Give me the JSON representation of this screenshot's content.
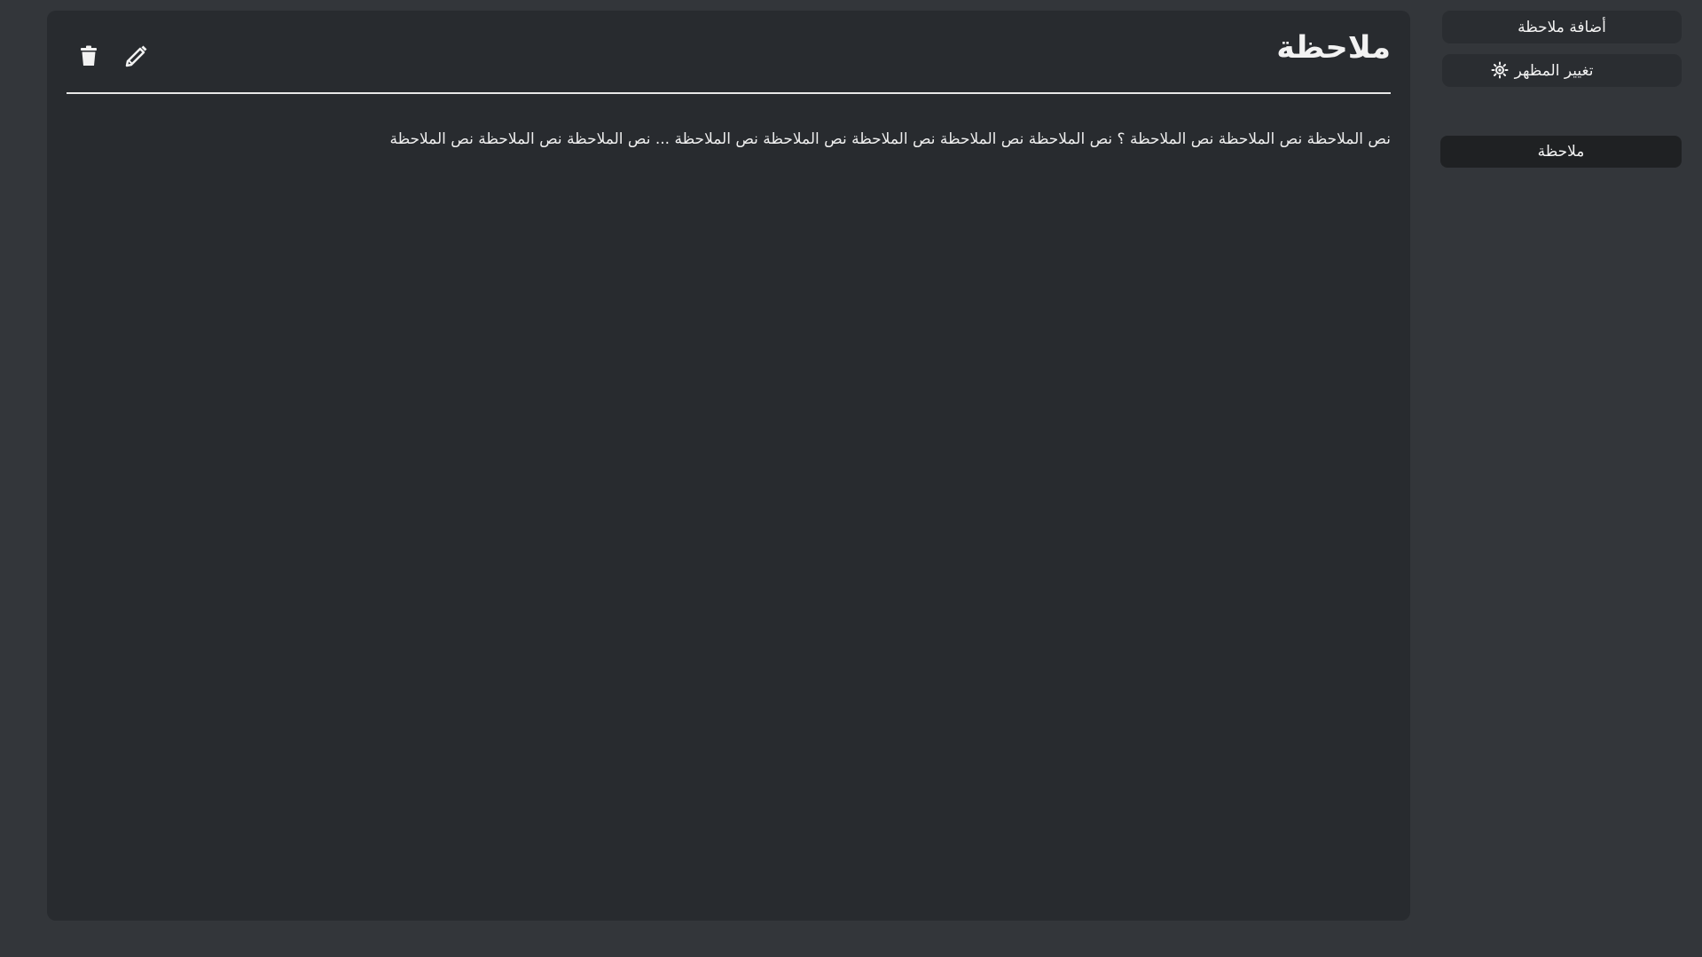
{
  "note": {
    "title": "ملاحظة",
    "body": "نص الملاحظة نص الملاحظة نص الملاحظة ؟ نص الملاحظة نص الملاحظة نص الملاحظة نص الملاحظة نص الملاحظة ... نص الملاحظة نص الملاحظة نص الملاحظة",
    "actions": {
      "edit_icon": "pencil-icon",
      "delete_icon": "trash-icon"
    }
  },
  "sidebar": {
    "add_note_label": "أضافة ملاحظة",
    "change_theme_label": "تغيير المظهر",
    "theme_icon": "sun-icon",
    "notes": [
      {
        "label": "ملاحظة"
      }
    ]
  },
  "colors": {
    "page_background": "#33363a",
    "panel_background": "#282b2f",
    "button_background": "#2a2d31",
    "selected_note_background": "#1f2123",
    "text": "#f2f2f2"
  }
}
